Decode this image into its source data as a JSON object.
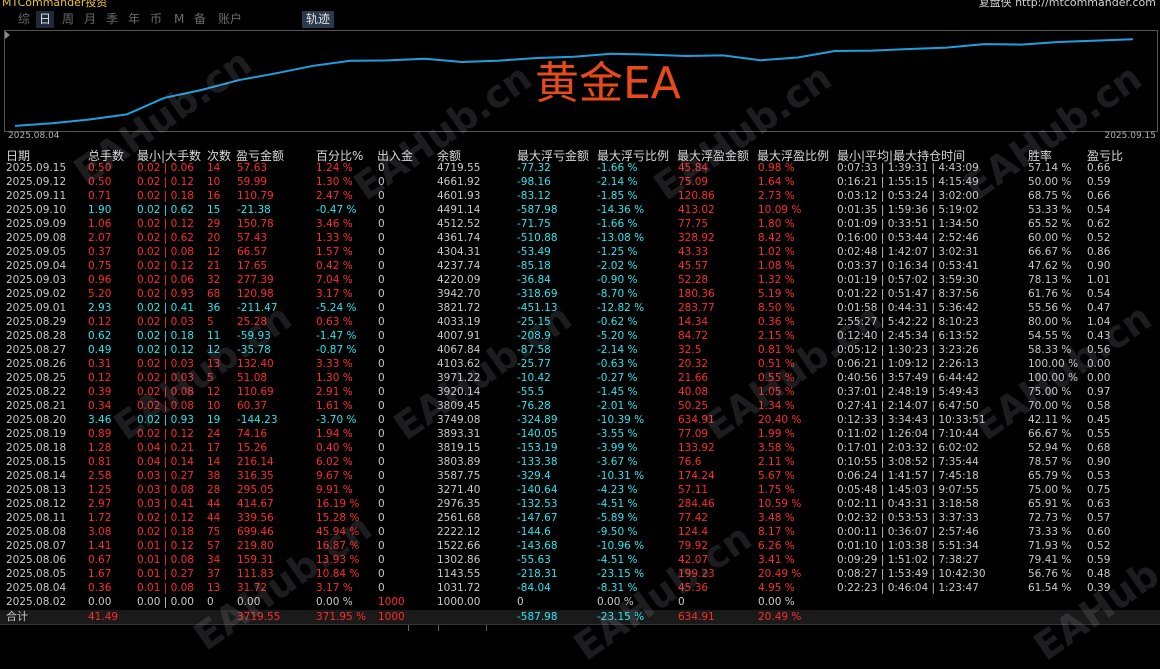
{
  "topbar": {
    "left": "MTCommander投资",
    "right": "复盘侠 http://mtcommander.com"
  },
  "tabs": [
    "综",
    "日",
    "周",
    "月",
    "季",
    "年",
    "币",
    "M",
    "备",
    "账户"
  ],
  "active_tab": "日",
  "track_button": "轨迹",
  "chart": {
    "title": "黄金EA",
    "start_date": "2025.08.04",
    "end_date": "2025.09.15",
    "line_color": "#1ea0e0"
  },
  "chart_data": {
    "type": "line",
    "x": [
      "2025.08.04",
      "2025.08.05",
      "2025.08.06",
      "2025.08.07",
      "2025.08.08",
      "2025.08.11",
      "2025.08.12",
      "2025.08.13",
      "2025.08.14",
      "2025.08.15",
      "2025.08.18",
      "2025.08.19",
      "2025.08.20",
      "2025.08.21",
      "2025.08.22",
      "2025.08.25",
      "2025.08.26",
      "2025.08.27",
      "2025.08.28",
      "2025.08.29",
      "2025.09.01",
      "2025.09.02",
      "2025.09.03",
      "2025.09.04",
      "2025.09.05",
      "2025.09.08",
      "2025.09.09",
      "2025.09.10",
      "2025.09.11",
      "2025.09.12",
      "2025.09.15"
    ],
    "series": [
      {
        "values": [
          1031.72,
          1143.55,
          1302.86,
          1522.66,
          2222.12,
          2561.68,
          2976.35,
          3271.4,
          3587.75,
          3803.89,
          3819.15,
          3893.31,
          3749.08,
          3809.45,
          3920.14,
          3971.22,
          4103.62,
          4067.84,
          4007.91,
          4033.19,
          3821.72,
          3942.7,
          4220.09,
          4237.74,
          4304.31,
          4361.74,
          4512.52,
          4491.14,
          4601.93,
          4661.92,
          4719.55
        ]
      }
    ],
    "title": "黄金EA"
  },
  "headers": [
    "日期",
    "总手数",
    "最小|大手数",
    "次数",
    "盈亏金额",
    "百分比%",
    "出入金",
    "余额",
    "最大浮亏金额",
    "最大浮亏比例",
    "最大浮盈金额",
    "最大浮盈比例",
    "最小|平均|最大持仓时间",
    "胜率",
    "盈亏比"
  ],
  "rows": [
    {
      "date": "2025.09.15",
      "lots": "0.50",
      "minmax": "0.02 | 0.06",
      "count": "14",
      "pnl": "57.63",
      "pct": "1.24 %",
      "io": "0",
      "bal": "4719.55",
      "mfl": "-77.32",
      "mflp": "-1.66 %",
      "mfp": "45.84",
      "mfpp": "0.98 %",
      "time": "0:07:33 | 1:39:31 | 4:43:09",
      "win": "57.14 %",
      "pl": "0.66",
      "color": "red"
    },
    {
      "date": "2025.09.12",
      "lots": "0.50",
      "minmax": "0.02 | 0.12",
      "count": "10",
      "pnl": "59.99",
      "pct": "1.30 %",
      "io": "0",
      "bal": "4661.92",
      "mfl": "-98.16",
      "mflp": "-2.14 %",
      "mfp": "75.09",
      "mfpp": "1.64 %",
      "time": "0:16:21 | 1:55:15 | 4:15:49",
      "win": "50.00 %",
      "pl": "0.59",
      "color": "red"
    },
    {
      "date": "2025.09.11",
      "lots": "0.71",
      "minmax": "0.02 | 0.18",
      "count": "16",
      "pnl": "110.79",
      "pct": "2.47 %",
      "io": "0",
      "bal": "4601.93",
      "mfl": "-83.12",
      "mflp": "-1.85 %",
      "mfp": "120.86",
      "mfpp": "2.73 %",
      "time": "0:03:12 | 0:53:24 | 3:02:00",
      "win": "68.75 %",
      "pl": "0.66",
      "color": "red"
    },
    {
      "date": "2025.09.10",
      "lots": "1.90",
      "minmax": "0.02 | 0.62",
      "count": "15",
      "pnl": "-21.38",
      "pct": "-0.47 %",
      "io": "0",
      "bal": "4491.14",
      "mfl": "-587.98",
      "mflp": "-14.36 %",
      "mfp": "413.02",
      "mfpp": "10.09 %",
      "time": "0:01:35 | 1:59:36 | 5:19:02",
      "win": "53.33 %",
      "pl": "0.54",
      "color": "cyan"
    },
    {
      "date": "2025.09.09",
      "lots": "1.06",
      "minmax": "0.02 | 0.12",
      "count": "29",
      "pnl": "150.78",
      "pct": "3.46 %",
      "io": "0",
      "bal": "4512.52",
      "mfl": "-71.75",
      "mflp": "-1.66 %",
      "mfp": "77.75",
      "mfpp": "1.80 %",
      "time": "0:01:09 | 0:33:51 | 1:34:50",
      "win": "65.52 %",
      "pl": "0.62",
      "color": "red"
    },
    {
      "date": "2025.09.08",
      "lots": "2.07",
      "minmax": "0.02 | 0.62",
      "count": "20",
      "pnl": "57.43",
      "pct": "1.33 %",
      "io": "0",
      "bal": "4361.74",
      "mfl": "-510.88",
      "mflp": "-13.08 %",
      "mfp": "328.92",
      "mfpp": "8.42 %",
      "time": "0:16:00 | 0:53:44 | 2:52:46",
      "win": "60.00 %",
      "pl": "0.52",
      "color": "red"
    },
    {
      "date": "2025.09.05",
      "lots": "0.37",
      "minmax": "0.02 | 0.08",
      "count": "12",
      "pnl": "66.57",
      "pct": "1.57 %",
      "io": "0",
      "bal": "4304.31",
      "mfl": "-53.49",
      "mflp": "-1.25 %",
      "mfp": "43.33",
      "mfpp": "1.02 %",
      "time": "0:02:48 | 1:42:07 | 3:02:31",
      "win": "66.67 %",
      "pl": "0.86",
      "color": "red"
    },
    {
      "date": "2025.09.04",
      "lots": "0.75",
      "minmax": "0.02 | 0.12",
      "count": "21",
      "pnl": "17.65",
      "pct": "0.42 %",
      "io": "0",
      "bal": "4237.74",
      "mfl": "-85.18",
      "mflp": "-2.02 %",
      "mfp": "45.57",
      "mfpp": "1.08 %",
      "time": "0:03:37 | 0:16:34 | 0:53:41",
      "win": "47.62 %",
      "pl": "0.90",
      "color": "red"
    },
    {
      "date": "2025.09.03",
      "lots": "0.96",
      "minmax": "0.02 | 0.06",
      "count": "32",
      "pnl": "277.39",
      "pct": "7.04 %",
      "io": "0",
      "bal": "4220.09",
      "mfl": "-36.84",
      "mflp": "-0.90 %",
      "mfp": "52.28",
      "mfpp": "1.32 %",
      "time": "0:01:19 | 0:57:02 | 3:59:30",
      "win": "78.13 %",
      "pl": "1.01",
      "color": "red"
    },
    {
      "date": "2025.09.02",
      "lots": "5.20",
      "minmax": "0.02 | 0.93",
      "count": "68",
      "pnl": "120.98",
      "pct": "3.17 %",
      "io": "0",
      "bal": "3942.70",
      "mfl": "-318.69",
      "mflp": "-8.70 %",
      "mfp": "180.36",
      "mfpp": "5.19 %",
      "time": "0:01:22 | 0:51:47 | 8:37:56",
      "win": "61.76 %",
      "pl": "0.54",
      "color": "red"
    },
    {
      "date": "2025.09.01",
      "lots": "2.93",
      "minmax": "0.02 | 0.41",
      "count": "36",
      "pnl": "-211.47",
      "pct": "-5.24 %",
      "io": "0",
      "bal": "3821.72",
      "mfl": "-451.13",
      "mflp": "-12.82 %",
      "mfp": "283.77",
      "mfpp": "8.50 %",
      "time": "0:01:58 | 0:44:31 | 5:36:42",
      "win": "55.56 %",
      "pl": "0.47",
      "color": "cyan"
    },
    {
      "date": "2025.08.29",
      "lots": "0.12",
      "minmax": "0.02 | 0.03",
      "count": "5",
      "pnl": "25.28",
      "pct": "0.63 %",
      "io": "0",
      "bal": "4033.19",
      "mfl": "-25.15",
      "mflp": "-0.62 %",
      "mfp": "14.34",
      "mfpp": "0.36 %",
      "time": "2:55:27 | 5:42:22 | 8:10:23",
      "win": "80.00 %",
      "pl": "1.04",
      "color": "red"
    },
    {
      "date": "2025.08.28",
      "lots": "0.62",
      "minmax": "0.02 | 0.18",
      "count": "11",
      "pnl": "-59.93",
      "pct": "-1.47 %",
      "io": "0",
      "bal": "4007.91",
      "mfl": "-208.9",
      "mflp": "-5.20 %",
      "mfp": "84.72",
      "mfpp": "2.15 %",
      "time": "0:12:40 | 2:45:34 | 6:13:52",
      "win": "54.55 %",
      "pl": "0.43",
      "color": "cyan"
    },
    {
      "date": "2025.08.27",
      "lots": "0.49",
      "minmax": "0.02 | 0.12",
      "count": "12",
      "pnl": "-35.78",
      "pct": "-0.87 %",
      "io": "0",
      "bal": "4067.84",
      "mfl": "-87.58",
      "mflp": "-2.14 %",
      "mfp": "32.5",
      "mfpp": "0.81 %",
      "time": "0:05:12 | 1:30:23 | 3:23:26",
      "win": "58.33 %",
      "pl": "0.56",
      "color": "cyan"
    },
    {
      "date": "2025.08.26",
      "lots": "0.31",
      "minmax": "0.02 | 0.03",
      "count": "13",
      "pnl": "132.40",
      "pct": "3.33 %",
      "io": "0",
      "bal": "4103.62",
      "mfl": "-25.77",
      "mflp": "-0.63 %",
      "mfp": "20.32",
      "mfpp": "0.51 %",
      "time": "0:06:21 | 1:09:12 | 2:26:13",
      "win": "100.00 %",
      "pl": "0.00",
      "color": "red"
    },
    {
      "date": "2025.08.25",
      "lots": "0.12",
      "minmax": "0.02 | 0.03",
      "count": "5",
      "pnl": "51.08",
      "pct": "1.30 %",
      "io": "0",
      "bal": "3971.22",
      "mfl": "-10.42",
      "mflp": "-0.27 %",
      "mfp": "21.66",
      "mfpp": "0.55 %",
      "time": "0:40:56 | 3:57:49 | 6:44:42",
      "win": "100.00 %",
      "pl": "0.00",
      "color": "red"
    },
    {
      "date": "2025.08.22",
      "lots": "0.39",
      "minmax": "0.02 | 0.08",
      "count": "12",
      "pnl": "110.69",
      "pct": "2.91 %",
      "io": "0",
      "bal": "3920.14",
      "mfl": "-55.5",
      "mflp": "-1.45 %",
      "mfp": "40.08",
      "mfpp": "1.05 %",
      "time": "0:37:01 | 2:48:19 | 5:49:43",
      "win": "75.00 %",
      "pl": "0.97",
      "color": "red"
    },
    {
      "date": "2025.08.21",
      "lots": "0.34",
      "minmax": "0.02 | 0.08",
      "count": "10",
      "pnl": "60.37",
      "pct": "1.61 %",
      "io": "0",
      "bal": "3809.45",
      "mfl": "-76.28",
      "mflp": "-2.01 %",
      "mfp": "50.25",
      "mfpp": "1.34 %",
      "time": "0:27:41 | 2:14:07 | 6:47:50",
      "win": "70.00 %",
      "pl": "0.58",
      "color": "red"
    },
    {
      "date": "2025.08.20",
      "lots": "3.46",
      "minmax": "0.02 | 0.93",
      "count": "19",
      "pnl": "-144.23",
      "pct": "-3.70 %",
      "io": "0",
      "bal": "3749.08",
      "mfl": "-324.89",
      "mflp": "-10.39 %",
      "mfp": "634.91",
      "mfpp": "20.40 %",
      "time": "0:12:33 | 3:34:43 | 10:33:51",
      "win": "42.11 %",
      "pl": "0.45",
      "color": "cyan"
    },
    {
      "date": "2025.08.19",
      "lots": "0.89",
      "minmax": "0.02 | 0.12",
      "count": "24",
      "pnl": "74.16",
      "pct": "1.94 %",
      "io": "0",
      "bal": "3893.31",
      "mfl": "-140.05",
      "mflp": "-3.55 %",
      "mfp": "77.09",
      "mfpp": "1.99 %",
      "time": "0:11:02 | 1:26:04 | 7:10:44",
      "win": "66.67 %",
      "pl": "0.55",
      "color": "red"
    },
    {
      "date": "2025.08.18",
      "lots": "1.28",
      "minmax": "0.04 | 0.21",
      "count": "17",
      "pnl": "15.26",
      "pct": "0.40 %",
      "io": "0",
      "bal": "3819.15",
      "mfl": "-153.19",
      "mflp": "-3.99 %",
      "mfp": "133.92",
      "mfpp": "3.58 %",
      "time": "0:17:01 | 2:03:32 | 6:02:02",
      "win": "52.94 %",
      "pl": "0.68",
      "color": "red"
    },
    {
      "date": "2025.08.15",
      "lots": "0.81",
      "minmax": "0.04 | 0.14",
      "count": "14",
      "pnl": "216.14",
      "pct": "6.02 %",
      "io": "0",
      "bal": "3803.89",
      "mfl": "-133.38",
      "mflp": "-3.67 %",
      "mfp": "76.6",
      "mfpp": "2.11 %",
      "time": "0:10:55 | 3:08:52 | 7:35:44",
      "win": "78.57 %",
      "pl": "0.90",
      "color": "red"
    },
    {
      "date": "2025.08.14",
      "lots": "2.58",
      "minmax": "0.03 | 0.27",
      "count": "38",
      "pnl": "316.35",
      "pct": "9.67 %",
      "io": "0",
      "bal": "3587.75",
      "mfl": "-329.4",
      "mflp": "-10.31 %",
      "mfp": "174.24",
      "mfpp": "5.67 %",
      "time": "0:06:24 | 1:41:57 | 7:45:18",
      "win": "65.79 %",
      "pl": "0.53",
      "color": "red"
    },
    {
      "date": "2025.08.13",
      "lots": "1.25",
      "minmax": "0.03 | 0.08",
      "count": "28",
      "pnl": "295.05",
      "pct": "9.91 %",
      "io": "0",
      "bal": "3271.40",
      "mfl": "-140.64",
      "mflp": "-4.23 %",
      "mfp": "57.11",
      "mfpp": "1.75 %",
      "time": "0:05:48 | 1:45:03 | 9:07:55",
      "win": "75.00 %",
      "pl": "0.75",
      "color": "red"
    },
    {
      "date": "2025.08.12",
      "lots": "2.97",
      "minmax": "0.03 | 0.41",
      "count": "44",
      "pnl": "414.67",
      "pct": "16.19 %",
      "io": "0",
      "bal": "2976.35",
      "mfl": "-132.53",
      "mflp": "-4.51 %",
      "mfp": "284.46",
      "mfpp": "10.59 %",
      "time": "0:02:11 | 0:43:31 | 3:18:58",
      "win": "65.91 %",
      "pl": "0.63",
      "color": "red"
    },
    {
      "date": "2025.08.11",
      "lots": "1.72",
      "minmax": "0.02 | 0.12",
      "count": "44",
      "pnl": "339.56",
      "pct": "15.28 %",
      "io": "0",
      "bal": "2561.68",
      "mfl": "-147.67",
      "mflp": "-5.89 %",
      "mfp": "77.42",
      "mfpp": "3.48 %",
      "time": "0:02:32 | 0:53:53 | 3:37:33",
      "win": "72.73 %",
      "pl": "0.57",
      "color": "red"
    },
    {
      "date": "2025.08.08",
      "lots": "3.08",
      "minmax": "0.02 | 0.18",
      "count": "75",
      "pnl": "699.46",
      "pct": "45.94 %",
      "io": "0",
      "bal": "2222.12",
      "mfl": "-144.6",
      "mflp": "-9.50 %",
      "mfp": "124.4",
      "mfpp": "8.17 %",
      "time": "0:00:11 | 0:36:07 | 2:57:46",
      "win": "73.33 %",
      "pl": "0.60",
      "color": "red"
    },
    {
      "date": "2025.08.07",
      "lots": "1.41",
      "minmax": "0.01 | 0.12",
      "count": "57",
      "pnl": "219.80",
      "pct": "16.87 %",
      "io": "0",
      "bal": "1522.66",
      "mfl": "-143.68",
      "mflp": "-10.96 %",
      "mfp": "79.92",
      "mfpp": "6.26 %",
      "time": "0:01:10 | 1:03:38 | 5:51:34",
      "win": "71.93 %",
      "pl": "0.52",
      "color": "red"
    },
    {
      "date": "2025.08.06",
      "lots": "0.67",
      "minmax": "0.01 | 0.08",
      "count": "34",
      "pnl": "159.31",
      "pct": "13.93 %",
      "io": "0",
      "bal": "1302.86",
      "mfl": "-55.63",
      "mflp": "-4.51 %",
      "mfp": "42.07",
      "mfpp": "3.41 %",
      "time": "0:09:29 | 1:51:02 | 7:38:27",
      "win": "79.41 %",
      "pl": "0.59",
      "color": "red"
    },
    {
      "date": "2025.08.05",
      "lots": "1.67",
      "minmax": "0.01 | 0.27",
      "count": "37",
      "pnl": "111.83",
      "pct": "10.84 %",
      "io": "0",
      "bal": "1143.55",
      "mfl": "-218.31",
      "mflp": "-23.15 %",
      "mfp": "199.23",
      "mfpp": "20.49 %",
      "time": "0:08:27 | 1:53:49 | 10:42:30",
      "win": "56.76 %",
      "pl": "0.48",
      "color": "red"
    },
    {
      "date": "2025.08.04",
      "lots": "0.36",
      "minmax": "0.01 | 0.08",
      "count": "13",
      "pnl": "31.72",
      "pct": "3.17 %",
      "io": "0",
      "bal": "1031.72",
      "mfl": "-84.04",
      "mflp": "-8.31 %",
      "mfp": "45.36",
      "mfpp": "4.95 %",
      "time": "0:22:23 | 0:46:04 | 1:23:47",
      "win": "61.54 %",
      "pl": "0.39",
      "color": "red"
    },
    {
      "date": "2025.08.02",
      "lots": "0.00",
      "minmax": "0.00 | 0.00",
      "count": "0",
      "pnl": "0.00",
      "pct": "0.00 %",
      "io": "1000",
      "bal": "1000.00",
      "mfl": "0",
      "mflp": "0.00 %",
      "mfp": "0",
      "mfpp": "0.00 %",
      "time": "",
      "win": "",
      "pl": "",
      "color": "white"
    }
  ],
  "total": {
    "label": "合计",
    "lots": "41.49",
    "pnl": "3719.55",
    "pct": "371.95 %",
    "io": "1000",
    "mfl": "-587.98",
    "mflp": "-23.15 %",
    "mfp": "634.91",
    "mfpp": "20.49 %"
  },
  "watermark": "EAHub.cn"
}
